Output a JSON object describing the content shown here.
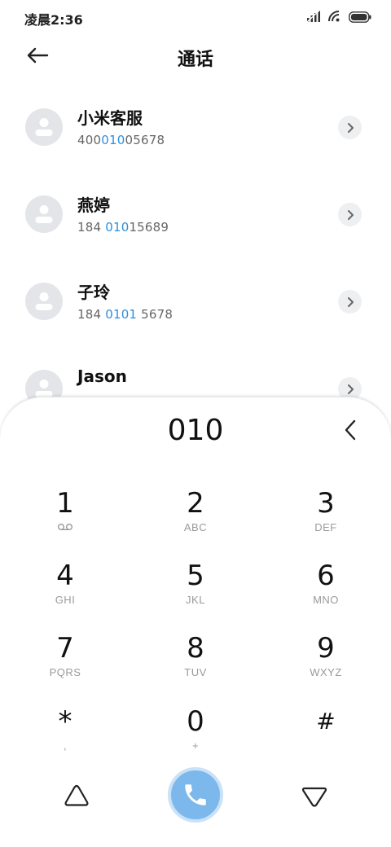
{
  "status_bar": {
    "time": "凌晨2:36",
    "icons": [
      "signal-icon",
      "wifi-icon",
      "battery-icon"
    ]
  },
  "header": {
    "title": "通话",
    "back_icon": "back-arrow-icon"
  },
  "contacts": [
    {
      "name": "小米客服",
      "number_parts": [
        "400",
        "010",
        "05678"
      ]
    },
    {
      "name": "燕婷",
      "number_parts": [
        "184 ",
        "010",
        "15689"
      ]
    },
    {
      "name": "子玲",
      "number_parts": [
        "184 ",
        "0101",
        " 5678"
      ]
    },
    {
      "name": "Jason",
      "number_parts": [
        "",
        "",
        ""
      ]
    }
  ],
  "dialer": {
    "input": "010",
    "keys": [
      {
        "digit": "1",
        "letters": ""
      },
      {
        "digit": "2",
        "letters": "ABC"
      },
      {
        "digit": "3",
        "letters": "DEF"
      },
      {
        "digit": "4",
        "letters": "GHI"
      },
      {
        "digit": "5",
        "letters": "JKL"
      },
      {
        "digit": "6",
        "letters": "MNO"
      },
      {
        "digit": "7",
        "letters": "PQRS"
      },
      {
        "digit": "8",
        "letters": "TUV"
      },
      {
        "digit": "9",
        "letters": "WXYZ"
      },
      {
        "digit": "*",
        "letters": ","
      },
      {
        "digit": "0",
        "letters": "+"
      },
      {
        "digit": "#",
        "letters": ""
      }
    ]
  },
  "colors": {
    "accent": "#2b8fe0",
    "call_button": "#7db8ec",
    "avatar_bg": "#e3e5e8"
  }
}
